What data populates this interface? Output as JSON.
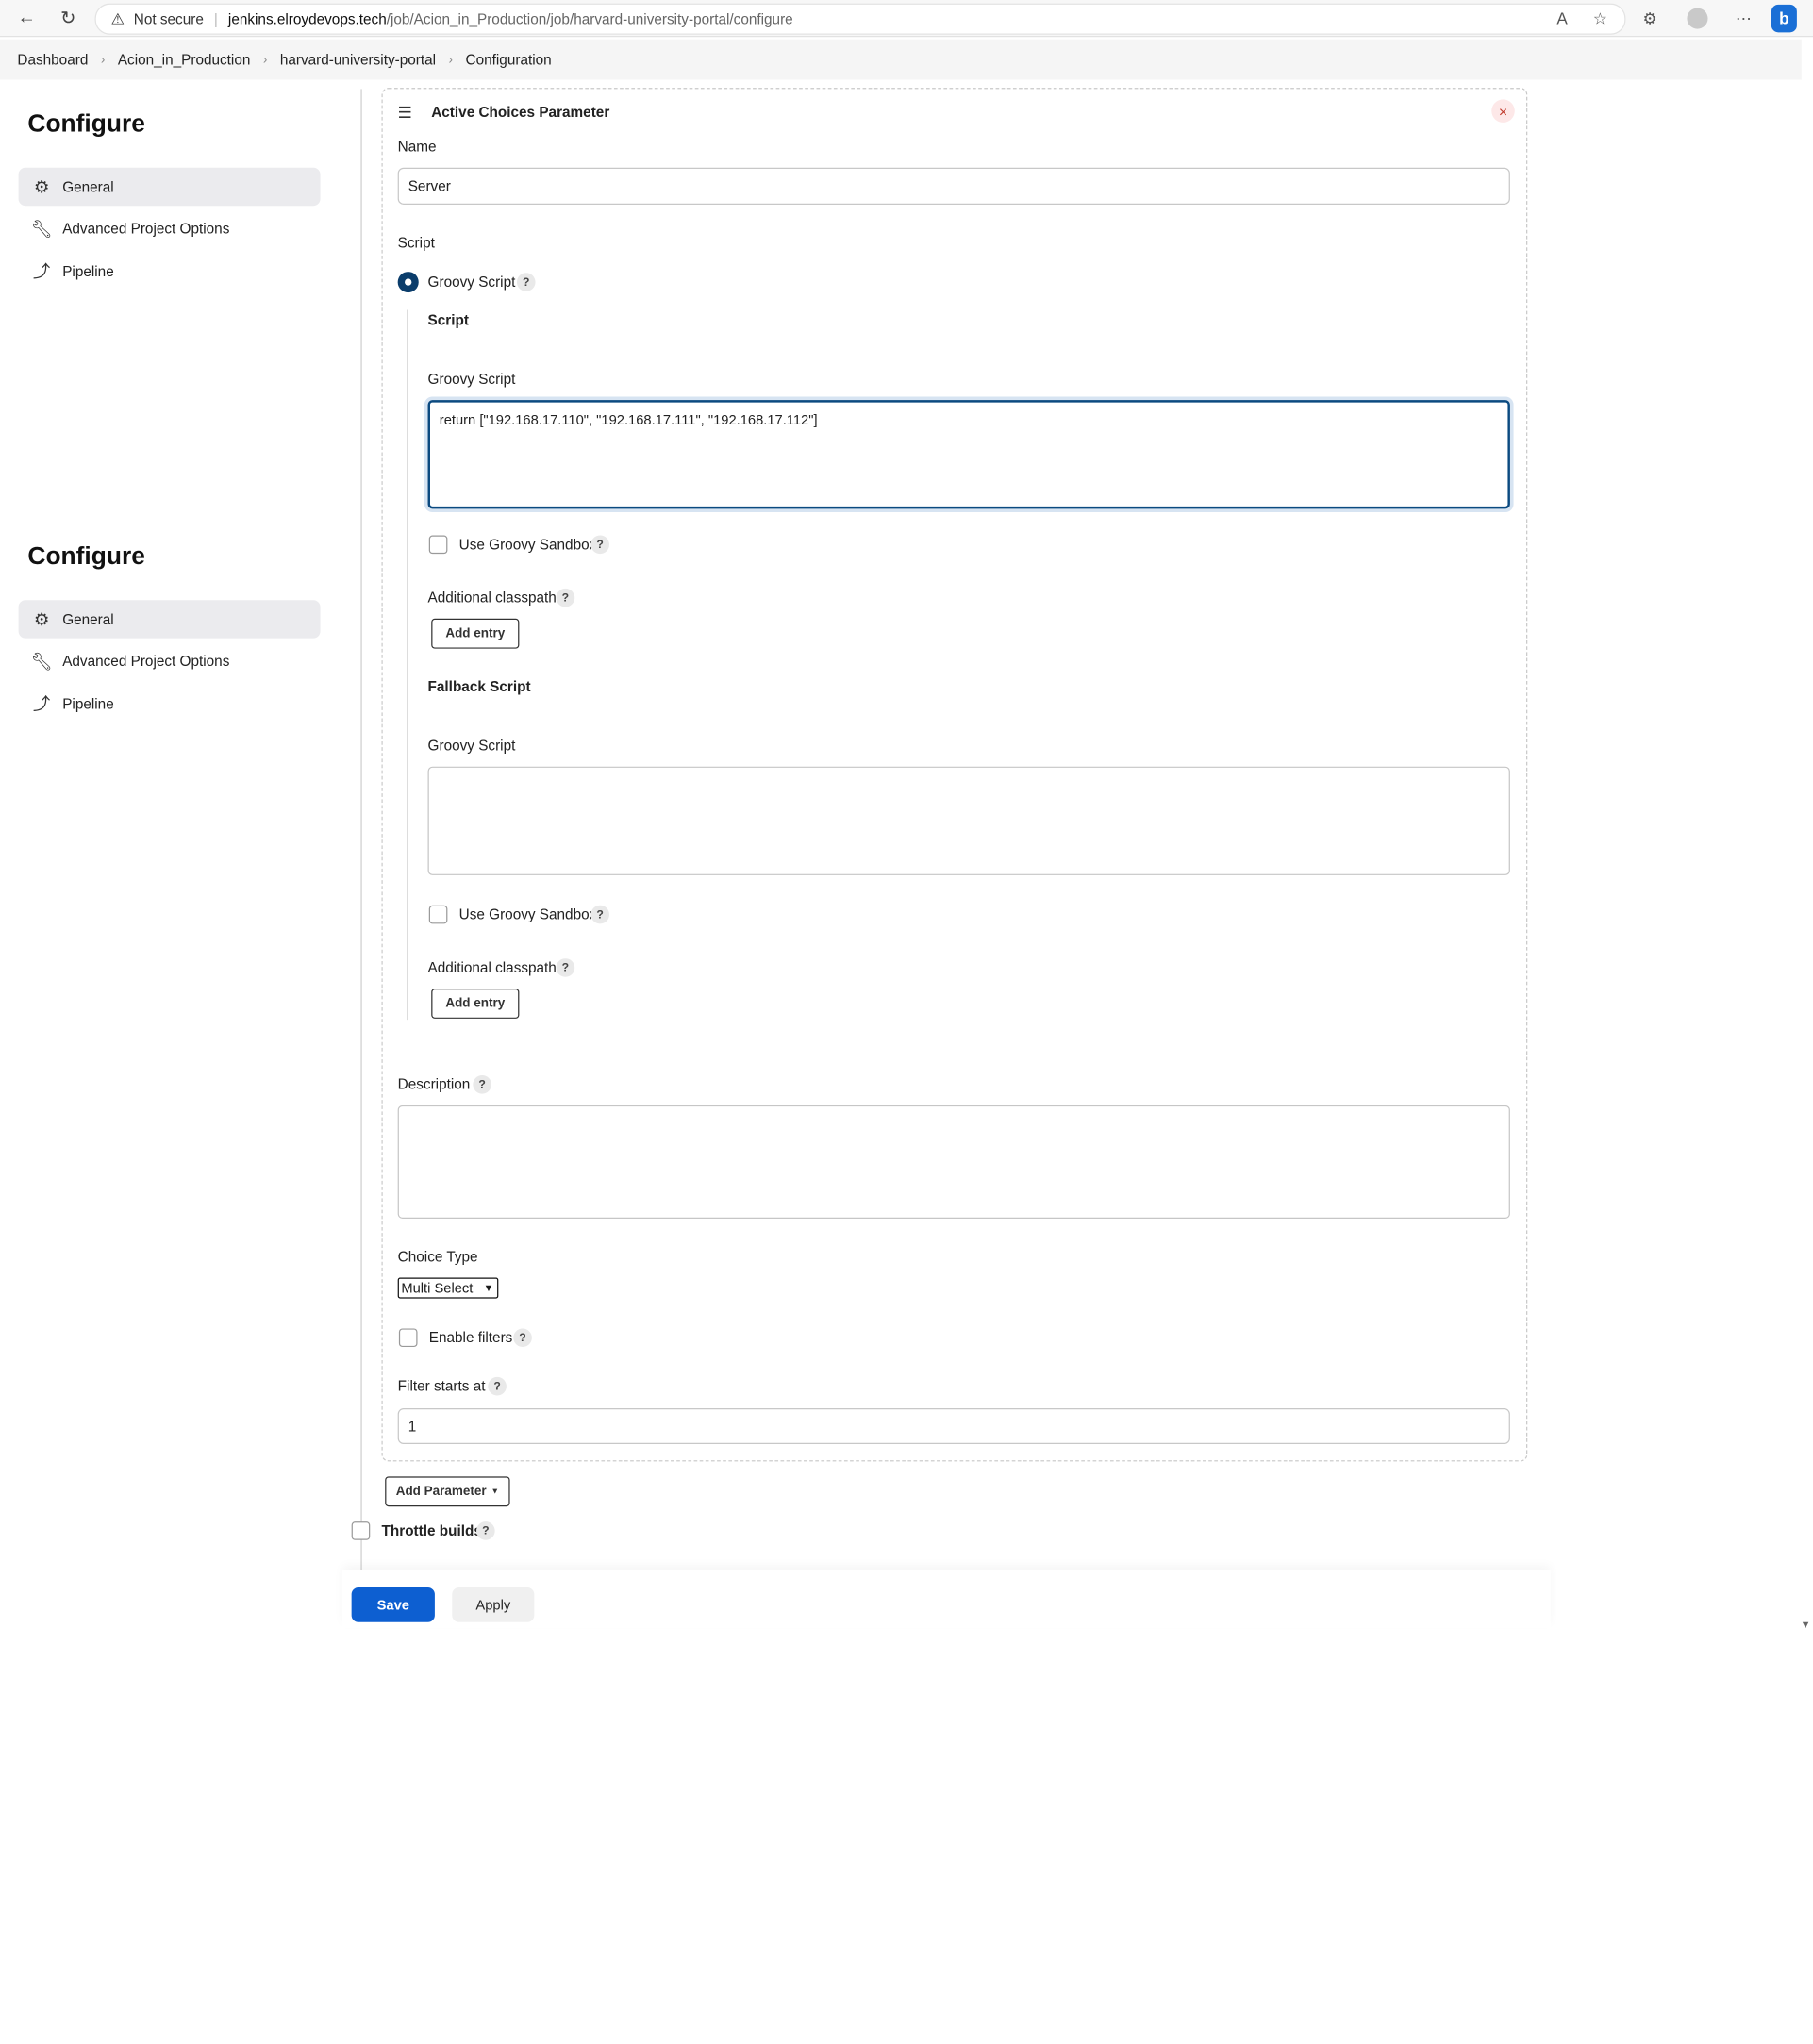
{
  "browser": {
    "security_label": "Not secure",
    "url_host": "jenkins.elroydevops.tech",
    "url_path": "/job/Acion_in_Production/job/harvard-university-portal/configure",
    "bing_label": "b"
  },
  "breadcrumb": [
    "Dashboard",
    "Acion_in_Production",
    "harvard-university-portal",
    "Configuration"
  ],
  "sidebar": {
    "title": "Configure",
    "items": [
      {
        "label": "General",
        "icon": "gear-icon"
      },
      {
        "label": "Advanced Project Options",
        "icon": "wrench-icon"
      },
      {
        "label": "Pipeline",
        "icon": "pipeline-icon"
      }
    ]
  },
  "param": {
    "header": "Active Choices Parameter",
    "name_label": "Name",
    "name_value": "Server",
    "script_label": "Script",
    "groovy_radio_label": "Groovy Script",
    "script_section_title": "Script",
    "groovy_script_label": "Groovy Script",
    "groovy_script_value": "return [\"192.168.17.110\", \"192.168.17.111\", \"192.168.17.112\"]",
    "sandbox_label": "Use Groovy Sandbox",
    "classpath_label": "Additional classpath",
    "add_entry_label": "Add entry",
    "fallback_title": "Fallback Script",
    "fallback_groovy_label": "Groovy Script",
    "fallback_groovy_value": "",
    "fallback_sandbox_label": "Use Groovy Sandbox",
    "fallback_classpath_label": "Additional classpath",
    "fallback_add_entry_label": "Add entry",
    "description_label": "Description",
    "description_value": "",
    "choice_type_label": "Choice Type",
    "choice_type_value": "Multi Select",
    "enable_filters_label": "Enable filters",
    "filter_starts_label": "Filter starts at",
    "filter_starts_value": "1"
  },
  "add_parameter_label": "Add Parameter",
  "throttle_label": "Throttle builds",
  "footer": {
    "save_label": "Save",
    "apply_label": "Apply"
  },
  "help_glyph": "?"
}
